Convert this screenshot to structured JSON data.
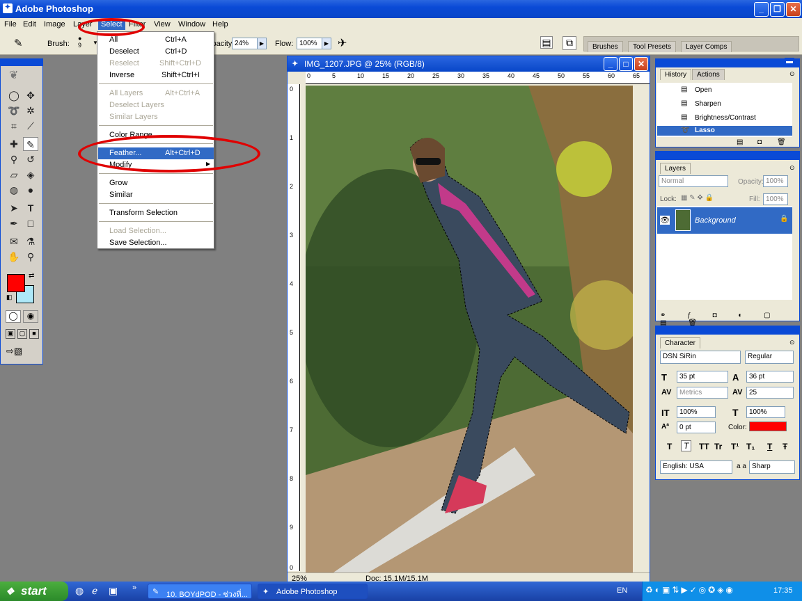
{
  "app": {
    "title": "Adobe Photoshop"
  },
  "menubar": [
    "File",
    "Edit",
    "Image",
    "Layer",
    "Select",
    "Filter",
    "View",
    "Window",
    "Help"
  ],
  "options": {
    "brush_label": "Brush:",
    "brush_size": "9",
    "opacity_label": "Opacity:",
    "opacity_value": "24%",
    "flow_label": "Flow:",
    "flow_value": "100%"
  },
  "palette_well": {
    "tabs": [
      "Brushes",
      "Tool Presets",
      "Layer Comps"
    ]
  },
  "select_menu": {
    "items": [
      {
        "label": "All",
        "shortcut": "Ctrl+A",
        "disabled": false
      },
      {
        "label": "Deselect",
        "shortcut": "Ctrl+D",
        "disabled": false
      },
      {
        "label": "Reselect",
        "shortcut": "Shift+Ctrl+D",
        "disabled": true
      },
      {
        "label": "Inverse",
        "shortcut": "Shift+Ctrl+I",
        "disabled": false
      },
      {
        "label": "All Layers",
        "shortcut": "Alt+Ctrl+A",
        "disabled": true
      },
      {
        "label": "Deselect Layers",
        "shortcut": "",
        "disabled": true
      },
      {
        "label": "Similar Layers",
        "shortcut": "",
        "disabled": true
      },
      {
        "label": "Color Range...",
        "shortcut": "",
        "disabled": false
      },
      {
        "label": "Feather...",
        "shortcut": "Alt+Ctrl+D",
        "disabled": false,
        "highlighted": true
      },
      {
        "label": "Modify",
        "shortcut": "",
        "disabled": false,
        "submenu": true
      },
      {
        "label": "Grow",
        "shortcut": "",
        "disabled": false
      },
      {
        "label": "Similar",
        "shortcut": "",
        "disabled": false
      },
      {
        "label": "Transform Selection",
        "shortcut": "",
        "disabled": false
      },
      {
        "label": "Load Selection...",
        "shortcut": "",
        "disabled": true
      },
      {
        "label": "Save Selection...",
        "shortcut": "",
        "disabled": false
      }
    ]
  },
  "document": {
    "title": "IMG_1207.JPG @ 25% (RGB/8)",
    "zoom": "25%",
    "doc_info": "Doc: 15.1M/15.1M",
    "ruler_h": [
      "0",
      "5",
      "10",
      "15",
      "20",
      "25",
      "30",
      "35",
      "40",
      "45",
      "50",
      "55",
      "60",
      "65"
    ],
    "ruler_v": [
      "0",
      "1",
      "2",
      "3",
      "4",
      "5",
      "6",
      "7",
      "8",
      "9",
      "0"
    ]
  },
  "history": {
    "tabs": [
      "History",
      "Actions"
    ],
    "items": [
      "Open",
      "Sharpen",
      "Brightness/Contrast",
      "Lasso"
    ]
  },
  "layers": {
    "tab": "Layers",
    "blend": "Normal",
    "opacity_label": "Opacity:",
    "opacity": "100%",
    "lock_label": "Lock:",
    "fill_label": "Fill:",
    "fill": "100%",
    "layer_name": "Background"
  },
  "character": {
    "tab": "Character",
    "font": "DSN SiRin",
    "style": "Regular",
    "size": "35 pt",
    "leading": "36 pt",
    "kerning": "Metrics",
    "tracking": "25",
    "vscale": "100%",
    "hscale": "100%",
    "baseline": "0 pt",
    "color_label": "Color:",
    "color": "#ff0000",
    "language": "English: USA",
    "aa_label": "a a",
    "aa": "Sharp",
    "style_buttons": [
      "T",
      "T",
      "TT",
      "Tr",
      "T¹",
      "T₁",
      "T",
      "Ŧ"
    ]
  },
  "colors": {
    "foreground": "#ff0000",
    "background": "#aee8f8",
    "accent": "#0a4ad6",
    "highlight": "#316ac5",
    "annotation": "#e00000"
  },
  "taskbar": {
    "start": "start",
    "tasks": [
      "10. BOYdPOD - ช่วงที่...",
      "Adobe Photoshop"
    ],
    "lang": "EN",
    "clock": "17:35"
  }
}
